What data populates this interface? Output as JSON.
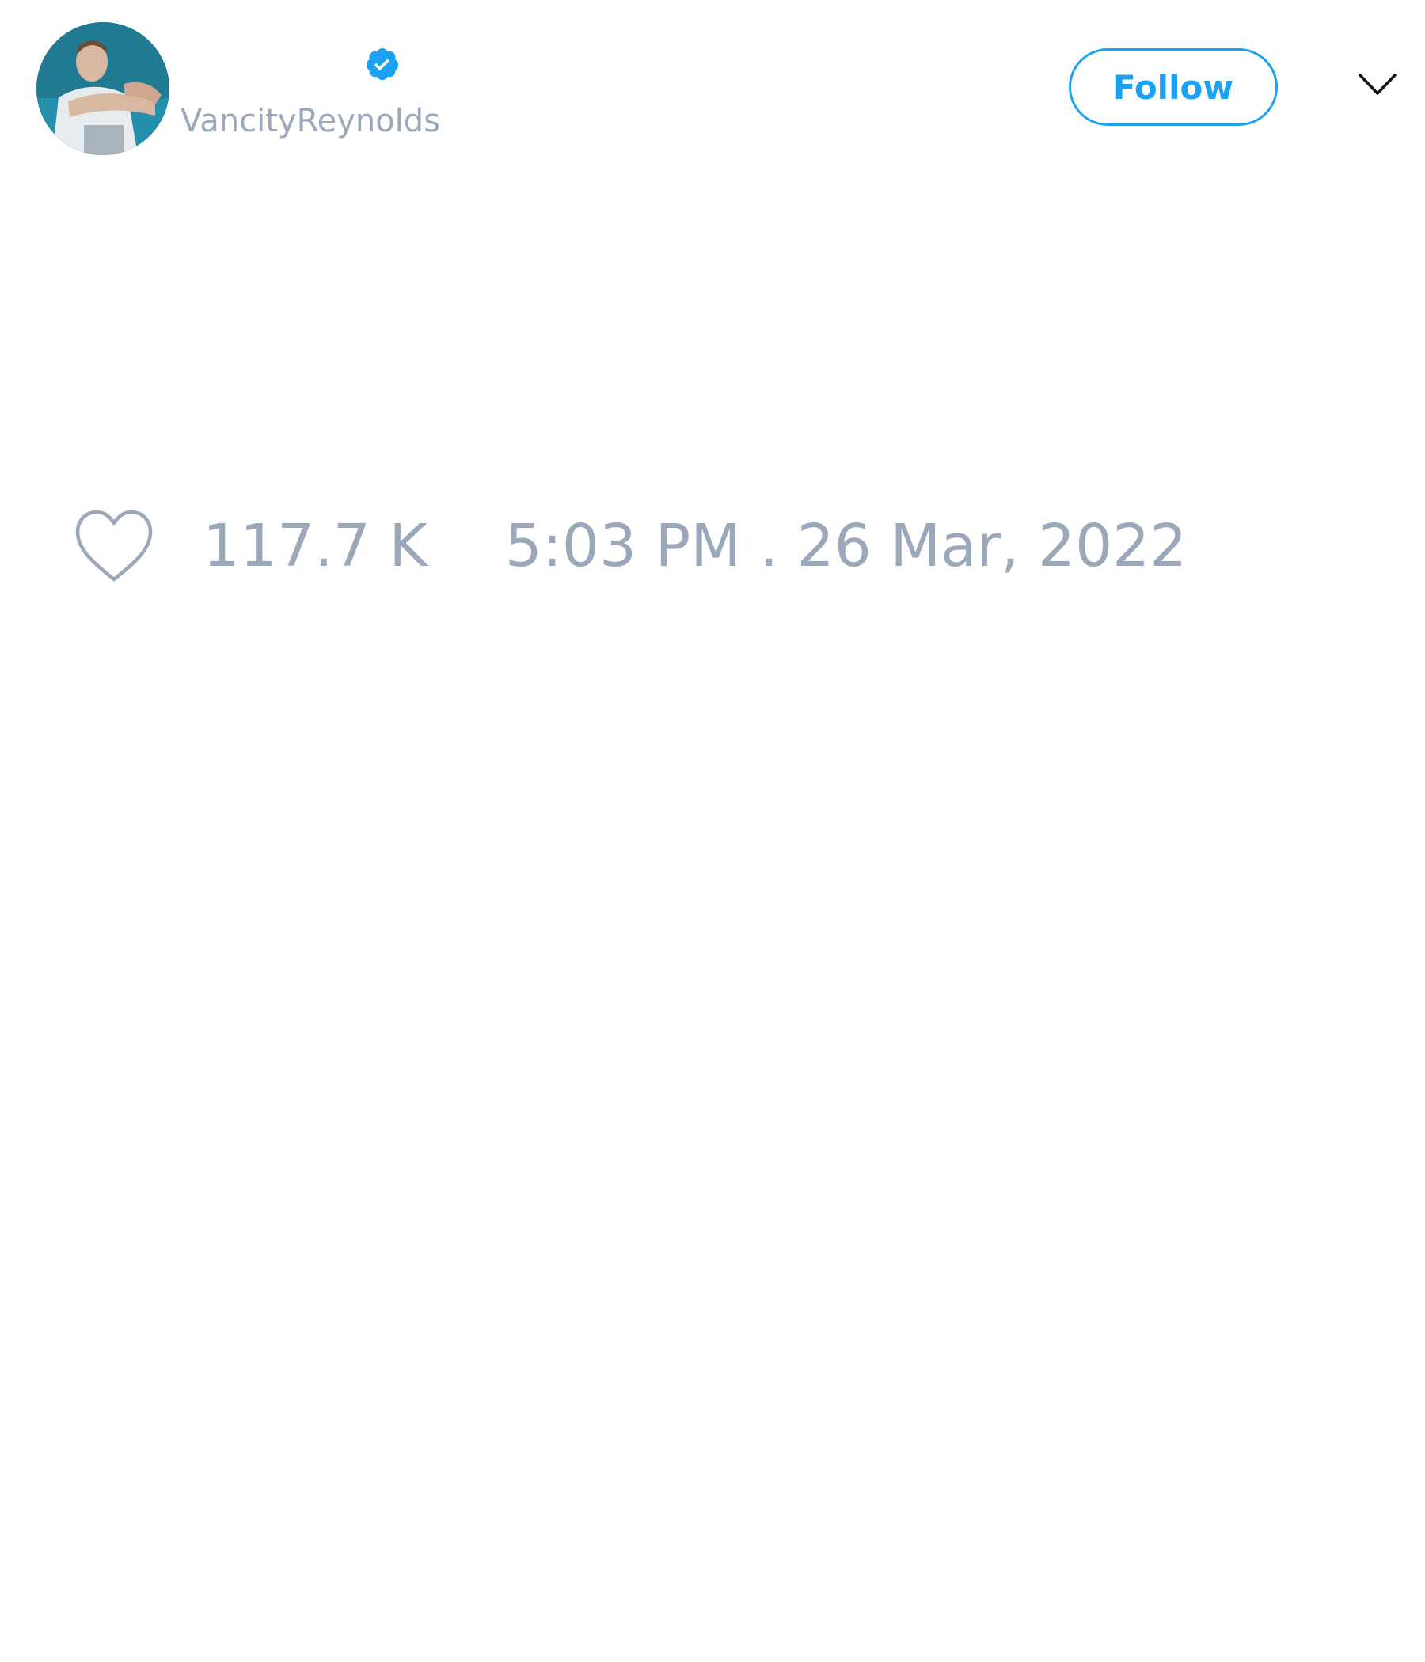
{
  "author": {
    "handle": "VancityReynolds",
    "verified": true,
    "avatar_icon": "profile-photo"
  },
  "header": {
    "follow_label": "Follow",
    "menu_icon": "chevron-down-icon"
  },
  "tweet": {
    "like_icon": "heart-icon",
    "like_count": "117.7 K",
    "timestamp": "5:03 PM . 26 Mar, 2022"
  },
  "colors": {
    "accent": "#1da1f2",
    "muted_text": "#9aa8ba",
    "background": "#ffffff"
  }
}
